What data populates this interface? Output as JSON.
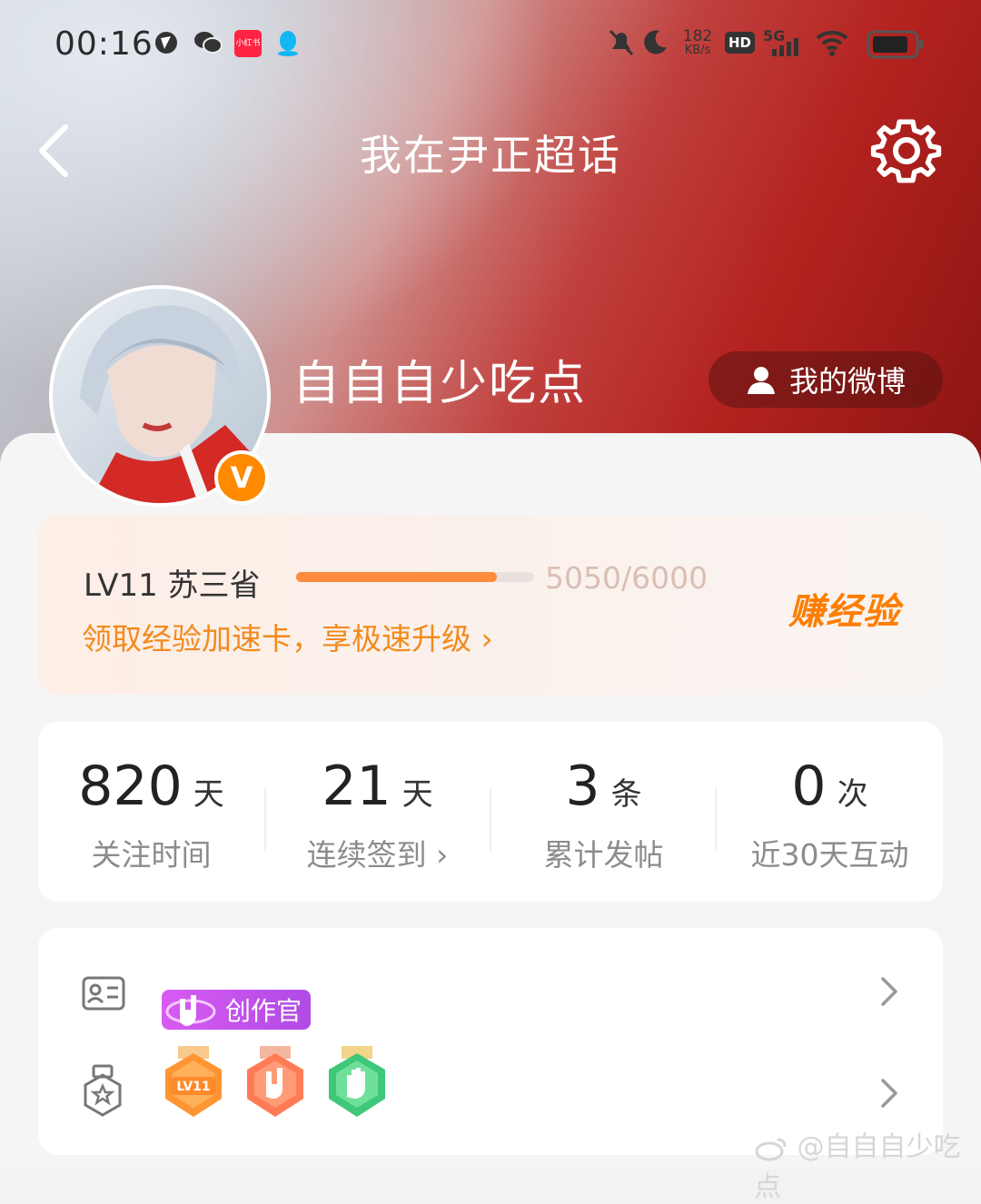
{
  "status_bar": {
    "time": "00:16",
    "app_notif_icon_label": "小红书",
    "net_speed_value": "182",
    "net_speed_unit": "KB/s",
    "hd_label": "HD",
    "network_label": "5G"
  },
  "nav": {
    "title": "我在尹正超话"
  },
  "profile": {
    "username": "自自自少吃点",
    "my_weibo_label": "我的微博",
    "verified_badge": "V"
  },
  "level": {
    "label": "LV11 苏三省",
    "progress_fraction": 0.8417,
    "score": "5050/6000",
    "promo": "领取经验加速卡，享极速升级 ›",
    "earn_label": "赚经验"
  },
  "stats": [
    {
      "value": "820",
      "unit": "天",
      "label": "关注时间"
    },
    {
      "value": "21",
      "unit": "天",
      "label": "连续签到 ›"
    },
    {
      "value": "3",
      "unit": "条",
      "label": "累计发帖"
    },
    {
      "value": "0",
      "unit": "次",
      "label": "近30天互动"
    }
  ],
  "badges": {
    "creator_label": "创作官",
    "medal_lv_label": "LV11"
  },
  "watermark": "@自自自少吃点",
  "colors": {
    "accent_orange": "#ff8b3d",
    "promo_orange": "#f28a1c",
    "creator_purple": "#b04ae6"
  }
}
